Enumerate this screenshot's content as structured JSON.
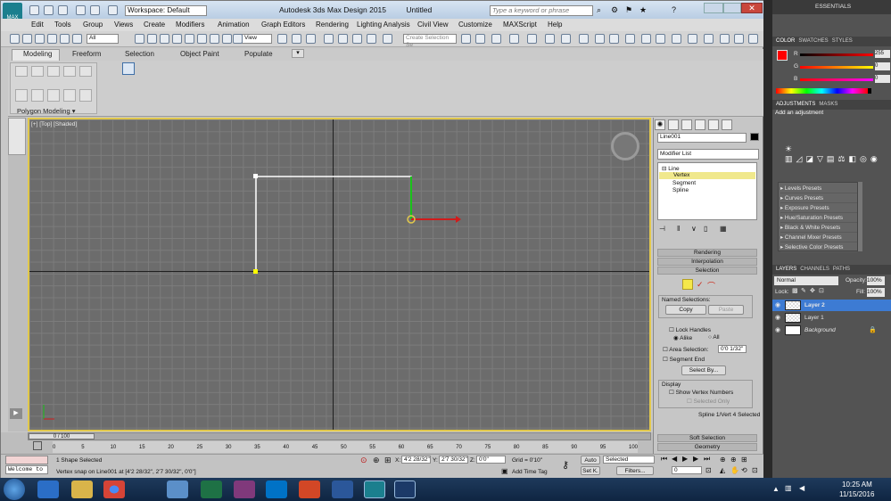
{
  "app": {
    "title": "Autodesk 3ds Max Design 2015",
    "doc": "Untitled",
    "workspace": "Workspace: Default",
    "search_placeholder": "Type a keyword or phrase",
    "logo": "MAX"
  },
  "menu": [
    "Edit",
    "Tools",
    "Group",
    "Views",
    "Create",
    "Modifiers",
    "Animation",
    "Graph Editors",
    "Rendering",
    "Lighting Analysis",
    "Civil View",
    "Customize",
    "MAXScript",
    "Help"
  ],
  "toolbar": {
    "filter": "All",
    "view": "View",
    "selection_set_placeholder": "Create Selection Se"
  },
  "ribbon": {
    "tabs": [
      "Modeling",
      "Freeform",
      "Selection",
      "Object Paint",
      "Populate"
    ],
    "group": "Polygon Modeling",
    "dropdown": "▾"
  },
  "viewport": {
    "label": "[+] [Top] [Shaded]"
  },
  "cmd": {
    "object_name": "Line001",
    "modifier_list": "Modifier List",
    "stack": [
      "Line",
      "Vertex",
      "Segment",
      "Spline"
    ],
    "rollouts": [
      "Rendering",
      "Interpolation",
      "Selection"
    ],
    "named_selections": "Named Selections:",
    "copy": "Copy",
    "paste": "Paste",
    "lock_handles": "Lock Handles",
    "alike": "Alike",
    "all": "All",
    "area_selection": "Area Selection:",
    "area_value": "0'0 1/32\"",
    "segment_end": "Segment End",
    "select_by": "Select By...",
    "display": "Display",
    "show_vertex_numbers": "Show Vertex Numbers",
    "selected_only": "Selected Only",
    "status": "Spline 1/Vert 4 Selected",
    "soft_selection": "Soft Selection",
    "geometry": "Geometry"
  },
  "timeline": {
    "frame": "0 / 100",
    "ticks": [
      "0",
      "5",
      "10",
      "15",
      "20",
      "25",
      "30",
      "35",
      "40",
      "45",
      "50",
      "55",
      "60",
      "65",
      "70",
      "75",
      "80",
      "85",
      "90",
      "95",
      "100"
    ]
  },
  "status": {
    "selected": "1 Shape Selected",
    "prompt": "Vertex snap on Line001 at [4'2 28/32\", 2'7 30/32\", 0'0\"]",
    "x_label": "X:",
    "x": "4'2 28/32\"",
    "y_label": "Y:",
    "y": "2'7 30/32\"",
    "z_label": "Z:",
    "z": "0'0\"",
    "grid": "Grid = 0'10\"",
    "add_time_tag": "Add Time Tag",
    "auto": "Auto",
    "set_k": "Set K.",
    "selected_dd": "Selected",
    "filters": "Filters...",
    "frame_field": "0",
    "listener": "Welcome to"
  },
  "ps": {
    "essentials": "ESSENTIALS",
    "tabs1": [
      "COLOR",
      "SWATCHES",
      "STYLES"
    ],
    "rgb": [
      {
        "label": "R",
        "value": "255"
      },
      {
        "label": "G",
        "value": "0"
      },
      {
        "label": "B",
        "value": "0"
      }
    ],
    "tabs2": [
      "ADJUSTMENTS",
      "MASKS"
    ],
    "add_adjustment": "Add an adjustment",
    "presets": [
      "Levels Presets",
      "Curves Presets",
      "Exposure Presets",
      "Hue/Saturation Presets",
      "Black & White Presets",
      "Channel Mixer Presets",
      "Selective Color Presets"
    ],
    "tabs3": [
      "LAYERS",
      "CHANNELS",
      "PATHS"
    ],
    "blend": "Normal",
    "opacity_label": "Opacity:",
    "opacity": "100%",
    "lock_label": "Lock:",
    "fill_label": "Fill:",
    "fill": "100%",
    "layers": [
      "Layer 2",
      "Layer 1",
      "Background"
    ]
  },
  "taskbar": {
    "time": "10:25 AM",
    "date": "11/15/2016"
  },
  "colors": {
    "accent": "#e1c84c",
    "fg": "#ff0000",
    "ps_select": "#3d7bd3"
  }
}
